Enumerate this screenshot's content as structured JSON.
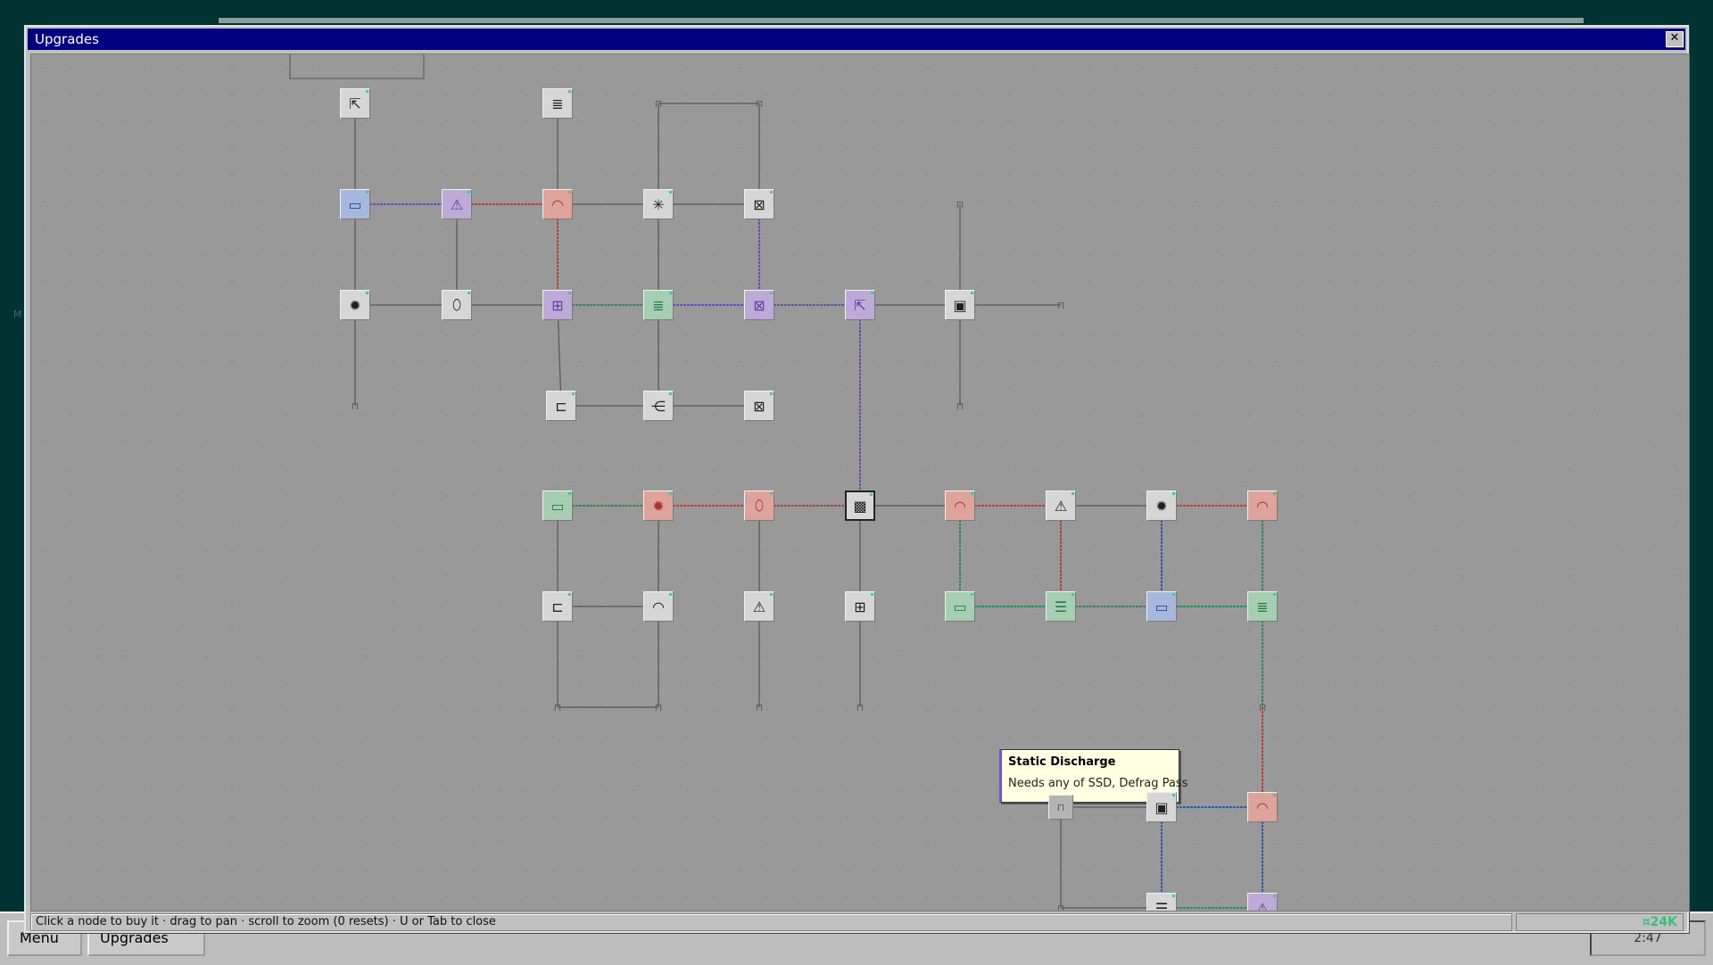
{
  "window": {
    "title": "Upgrades",
    "close_icon": "close-icon"
  },
  "statusbar": {
    "hint": "Click a node to buy it · drag to pan · scroll to zoom (0 resets) · U or Tab to close",
    "currency": "¤24K"
  },
  "tooltip": {
    "title": "Static Discharge",
    "body": "Needs any of SSD, Defrag Pass"
  },
  "taskbar": {
    "menu_label": "Menu",
    "upgrades_label": "Upgrades",
    "clock": "2:47"
  },
  "colors": {
    "gray": "#d6d6d6",
    "blue": "#a6b8dd",
    "purple": "#bdaad6",
    "red": "#dea49c",
    "green": "#a6cfb2",
    "title_bar": "#000080"
  },
  "nodes": [
    {
      "icon": "cursor-icon",
      "color": "gray",
      "glyph": "⇱"
    },
    {
      "icon": "lines-icon",
      "color": "gray",
      "glyph": "≣"
    },
    {
      "icon": "lock-icon",
      "color": "lock",
      "glyph": "⊓"
    },
    {
      "icon": "lock-icon",
      "color": "lock",
      "glyph": "⊓"
    },
    {
      "icon": "card-icon",
      "color": "blue",
      "glyph": "▭"
    },
    {
      "icon": "warning-icon",
      "color": "purple",
      "glyph": "⚠"
    },
    {
      "icon": "gauge-icon",
      "color": "red",
      "glyph": "◠"
    },
    {
      "icon": "sparkle-icon",
      "color": "gray",
      "glyph": "✳"
    },
    {
      "icon": "crossbox-icon",
      "color": "gray",
      "glyph": "⊠"
    },
    {
      "icon": "lock-icon",
      "color": "lock",
      "glyph": "⊓"
    },
    {
      "icon": "gear-icon",
      "color": "gray",
      "glyph": "✹"
    },
    {
      "icon": "mouse-icon",
      "color": "gray",
      "glyph": "⬯"
    },
    {
      "icon": "split-icon",
      "color": "purple",
      "glyph": "⊞"
    },
    {
      "icon": "lines-icon",
      "color": "green",
      "glyph": "≣"
    },
    {
      "icon": "crossbox-icon",
      "color": "purple",
      "glyph": "⊠"
    },
    {
      "icon": "cursor-icon",
      "color": "purple",
      "glyph": "⇱"
    },
    {
      "icon": "disk-icon",
      "color": "gray",
      "glyph": "▣"
    },
    {
      "icon": "lock-icon",
      "color": "lock",
      "glyph": "⊓"
    },
    {
      "icon": "lock-icon",
      "color": "lock",
      "glyph": "⊓"
    },
    {
      "icon": "cable-icon",
      "color": "gray",
      "glyph": "⊏"
    },
    {
      "icon": "fork-icon",
      "color": "gray",
      "glyph": "⋲"
    },
    {
      "icon": "crossbox-icon",
      "color": "gray",
      "glyph": "⊠"
    },
    {
      "icon": "lock-icon",
      "color": "lock",
      "glyph": "⊓"
    },
    {
      "icon": "bar-icon",
      "color": "green",
      "glyph": "▭"
    },
    {
      "icon": "gear-icon",
      "color": "red",
      "glyph": "✹"
    },
    {
      "icon": "mouse-icon",
      "color": "red",
      "glyph": "⬯"
    },
    {
      "icon": "chip-icon",
      "color": "black",
      "glyph": "▩"
    },
    {
      "icon": "gauge-icon",
      "color": "red",
      "glyph": "◠"
    },
    {
      "icon": "warning-icon",
      "color": "gray",
      "glyph": "⚠"
    },
    {
      "icon": "gear-icon",
      "color": "gray",
      "glyph": "✹"
    },
    {
      "icon": "gauge-icon",
      "color": "red",
      "glyph": "◠"
    },
    {
      "icon": "cable-icon",
      "color": "gray",
      "glyph": "⊏"
    },
    {
      "icon": "gauge-icon",
      "color": "gray",
      "glyph": "◠"
    },
    {
      "icon": "warning-icon",
      "color": "gray",
      "glyph": "⚠"
    },
    {
      "icon": "split-icon",
      "color": "gray",
      "glyph": "⊞"
    },
    {
      "icon": "bar-icon",
      "color": "green",
      "glyph": "▭"
    },
    {
      "icon": "stack-icon",
      "color": "green",
      "glyph": "☰"
    },
    {
      "icon": "card-icon",
      "color": "blue",
      "glyph": "▭"
    },
    {
      "icon": "lines-icon",
      "color": "green",
      "glyph": "≣"
    },
    {
      "icon": "lock-icon",
      "color": "lock",
      "glyph": "⊓"
    },
    {
      "icon": "lock-icon",
      "color": "lock",
      "glyph": "⊓"
    },
    {
      "icon": "lock-icon",
      "color": "lock",
      "glyph": "⊓"
    },
    {
      "icon": "lock-icon",
      "color": "lock",
      "glyph": "⊓"
    },
    {
      "icon": "lock-icon",
      "color": "lock",
      "glyph": "⊓"
    },
    {
      "icon": "bar-icon",
      "color": "green",
      "glyph": "▭"
    },
    {
      "icon": "lock-icon",
      "color": "lockbox",
      "glyph": "⊓"
    },
    {
      "icon": "disk-icon",
      "color": "gray",
      "glyph": "▣"
    },
    {
      "icon": "gauge-icon",
      "color": "red",
      "glyph": "◠"
    },
    {
      "icon": "lock-icon",
      "color": "lock",
      "glyph": "⊓"
    },
    {
      "icon": "stack-icon",
      "color": "gray",
      "glyph": "☰"
    },
    {
      "icon": "warning-icon",
      "color": "purple",
      "glyph": "⚠"
    }
  ]
}
